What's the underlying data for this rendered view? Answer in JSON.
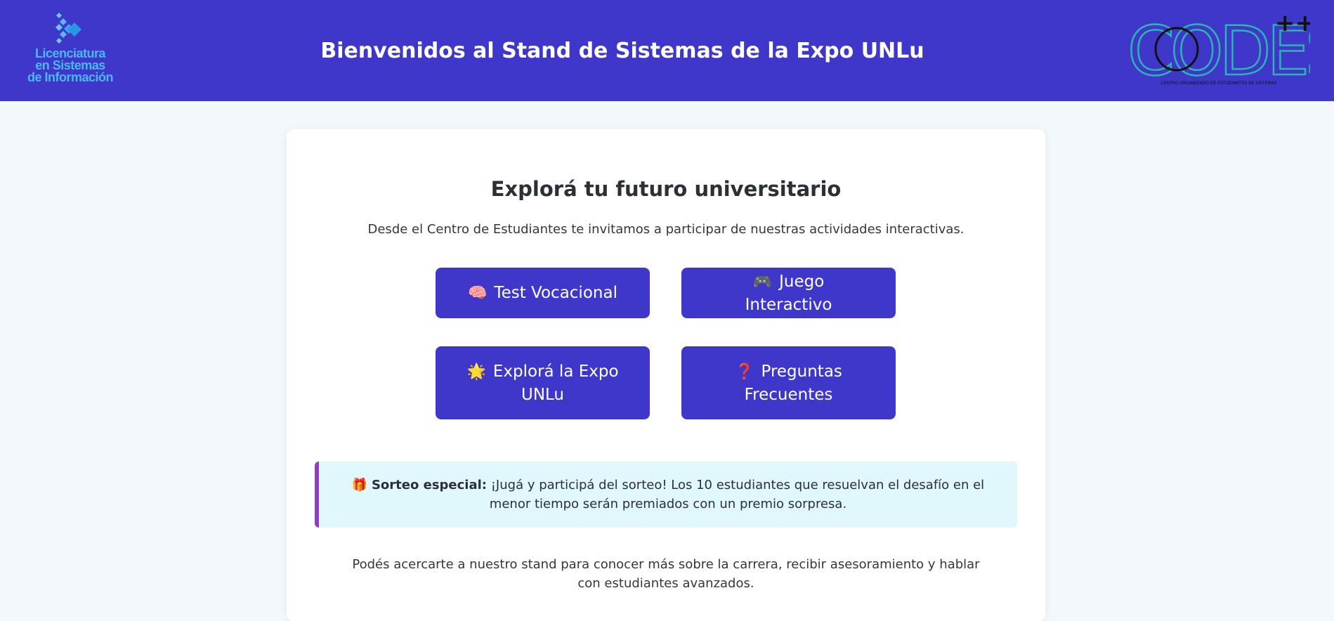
{
  "header": {
    "logo_left_lines": [
      "Licenciatura",
      "en Sistemas",
      "de Información"
    ],
    "title": "Bienvenidos al Stand de Sistemas de la Expo UNLu",
    "logo_right_word": "CODES",
    "logo_right_plus": "++",
    "logo_right_caption": "CENTRO ORGANIZADO DE ESTUDIANTES DE SISTEMAS"
  },
  "main": {
    "title": "Explorá tu futuro universitario",
    "subtitle": "Desde el Centro de Estudiantes te invitamos a participar de nuestras actividades interactivas.",
    "buttons": [
      {
        "emoji": "🧠",
        "label": "Test Vocacional"
      },
      {
        "emoji": "🎮",
        "label": "Juego Interactivo"
      },
      {
        "emoji": "🌟",
        "label": "Explorá la Expo UNLu"
      },
      {
        "emoji": "❓",
        "label": "Preguntas Frecuentes"
      }
    ],
    "raffle": {
      "emoji": "🎁",
      "bold": "Sorteo especial:",
      "text": " ¡Jugá y participá del sorteo! Los 10 estudiantes que resuelvan el desafío en el menor tiempo serán premiados con un premio sorpresa."
    },
    "footer_text": "Podés acercarte a nuestro stand para conocer más sobre la carrera, recibir asesoramiento y hablar con estudiantes avanzados."
  },
  "colors": {
    "header_bg": "#3f37c9",
    "button_bg": "#3f37c9",
    "raffle_bg": "#e0f8fb",
    "raffle_accent": "#8e3ec3",
    "logo_blue": "#4ab8f5",
    "codes_teal": "#2bb5b0"
  }
}
